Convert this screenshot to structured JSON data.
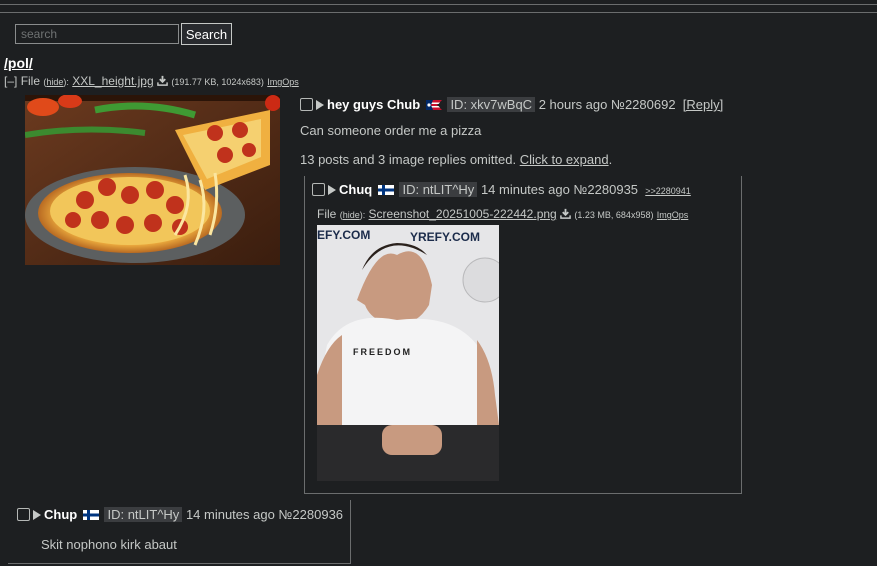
{
  "search": {
    "placeholder": "search",
    "button": "Search"
  },
  "board": "/pol/",
  "op": {
    "collapse": "[–]",
    "file_label": "File",
    "hide": "hide",
    "filename": "XXL_height.jpg",
    "fileinfo": "(191.77 KB, 1024x683)",
    "imgops": "ImgOps",
    "name": "hey guys Chub",
    "id": "ID: xkv7wBqC",
    "time": "2 hours ago",
    "postno": "№2280692",
    "reply": "[Reply]",
    "message": "Can someone order me a pizza",
    "omitted_text": "13 posts and 3 image replies omitted.",
    "expand": "Click to expand"
  },
  "reply1": {
    "name": "Chuq",
    "id": "ID: ntLIT^Hy",
    "time": "14 minutes ago",
    "postno": "№2280935",
    "backlink": ">>2280941",
    "file_label": "File",
    "hide": "hide",
    "filename": "Screenshot_20251005-222442.png",
    "fileinfo": "(1.23 MB, 684x958)",
    "imgops": "ImgOps",
    "shirt_text": "FREEDOM",
    "banner_left": "EFY.COM",
    "banner_right": "YREFY.COM"
  },
  "reply2": {
    "name": "Chup",
    "id": "ID: ntLIT^Hy",
    "time": "14 minutes ago",
    "postno": "№2280936",
    "message": "Skit nophono kirk abaut"
  },
  "colors": {
    "background": "#1d1f21",
    "text": "#c5c8c6",
    "name": "#ffffff",
    "id_bg": "#3b3d40"
  }
}
